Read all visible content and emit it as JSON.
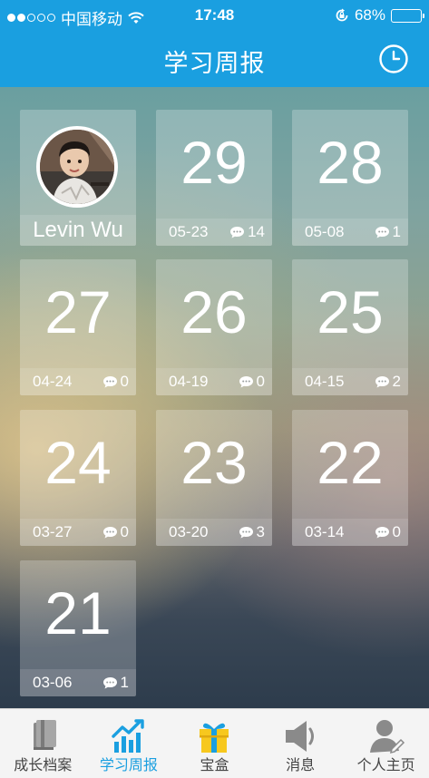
{
  "status_bar": {
    "carrier": "中国移动",
    "time": "17:48",
    "battery": "68%",
    "battery_level": 0.68,
    "signal_bars_filled": 2,
    "signal_bars_total": 5
  },
  "nav": {
    "title": "学习周报",
    "right_icon": "clock-history-icon"
  },
  "profile": {
    "name": "Levin Wu"
  },
  "reports": [
    {
      "number": "29",
      "date": "05-23",
      "comments": "14"
    },
    {
      "number": "28",
      "date": "05-08",
      "comments": "1"
    },
    {
      "number": "27",
      "date": "04-24",
      "comments": "0"
    },
    {
      "number": "26",
      "date": "04-19",
      "comments": "0"
    },
    {
      "number": "25",
      "date": "04-15",
      "comments": "2"
    },
    {
      "number": "24",
      "date": "03-27",
      "comments": "0"
    },
    {
      "number": "23",
      "date": "03-20",
      "comments": "3"
    },
    {
      "number": "22",
      "date": "03-14",
      "comments": "0"
    },
    {
      "number": "21",
      "date": "03-06",
      "comments": "1"
    }
  ],
  "tabs": [
    {
      "label": "成长档案",
      "icon": "book-icon",
      "active": false
    },
    {
      "label": "学习周报",
      "icon": "chart-trend-icon",
      "active": true
    },
    {
      "label": "宝盒",
      "icon": "gift-box-icon",
      "active": false
    },
    {
      "label": "消息",
      "icon": "speaker-icon",
      "active": false
    },
    {
      "label": "个人主页",
      "icon": "user-edit-icon",
      "active": false
    }
  ],
  "colors": {
    "accent": "#1a9fe0",
    "gift_yellow": "#f7c81e",
    "tab_inactive_icon": "#8a8a8a"
  }
}
